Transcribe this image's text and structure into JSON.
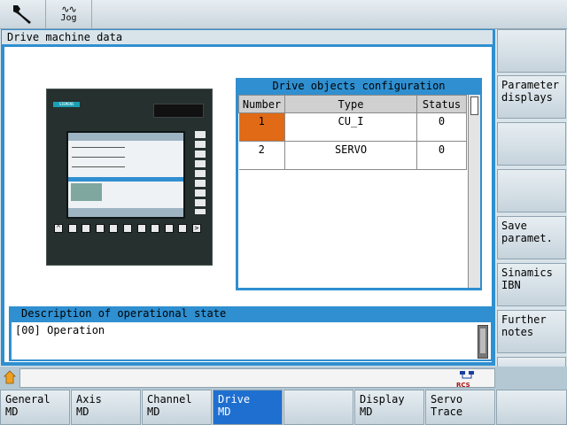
{
  "topbar": {
    "wrench_icon": "wrench-icon",
    "jog_label": "Jog",
    "jog_icon": "jog-wave-icon"
  },
  "window": {
    "title": "Drive machine data"
  },
  "panel_image": {
    "brand": "SIEMENS",
    "left_key": "^",
    "right_key": ">"
  },
  "config": {
    "title": "Drive objects configuration",
    "columns": [
      "Number",
      "Type",
      "Status"
    ],
    "rows": [
      {
        "number": "1",
        "type": "CU_I",
        "status": "0"
      },
      {
        "number": "2",
        "type": "SERVO",
        "status": "0"
      }
    ],
    "selected_color": "#e06a16"
  },
  "description": {
    "title": "Description of operational state",
    "text": "[00] Operation"
  },
  "vertical_softkeys": [
    {
      "label": ""
    },
    {
      "label": "Parameter\ndisplays"
    },
    {
      "label": ""
    },
    {
      "label": ""
    },
    {
      "label": "Save\nparamet."
    },
    {
      "label": "Sinamics\nIBN"
    },
    {
      "label": "Further\nnotes"
    },
    {
      "label": ""
    }
  ],
  "horizontal_softkeys": [
    {
      "label": "General\nMD",
      "active": false
    },
    {
      "label": "Axis\nMD",
      "active": false
    },
    {
      "label": "Channel\nMD",
      "active": false
    },
    {
      "label": "Drive\nMD",
      "active": true
    },
    {
      "label": "",
      "active": false
    },
    {
      "label": "Display\nMD",
      "active": false
    },
    {
      "label": "Servo\nTrace",
      "active": false
    },
    {
      "label": "",
      "active": false
    }
  ],
  "status": {
    "home_icon": "home-icon",
    "network_icon": "network-icon",
    "network_label": "RCS"
  },
  "colors": {
    "accent": "#2f8fd0",
    "active_softkey": "#1f6fd0"
  }
}
